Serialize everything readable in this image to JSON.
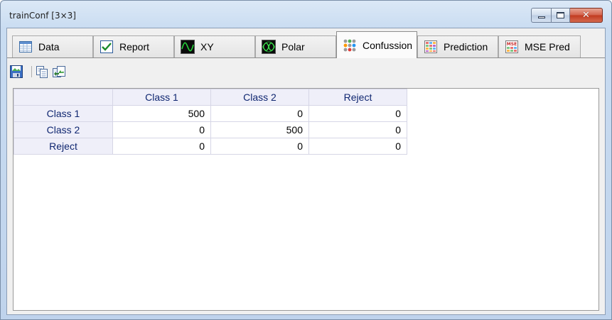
{
  "window": {
    "title": "trainConf [3×3]",
    "buttons": {
      "minimize": "minimize",
      "maximize": "maximize",
      "close": "✕"
    }
  },
  "tabs": [
    {
      "label": "Data",
      "icon": "table-icon",
      "active": false
    },
    {
      "label": "Report",
      "icon": "checkmark-icon",
      "active": false
    },
    {
      "label": "XY",
      "icon": "waveform-icon",
      "active": false
    },
    {
      "label": "Polar",
      "icon": "polar-plot-icon",
      "active": false
    },
    {
      "label": "Confussion",
      "icon": "colored-dots-icon",
      "active": true
    },
    {
      "label": "Prediction",
      "icon": "colored-grid-icon",
      "active": false
    },
    {
      "label": "MSE Pred",
      "icon": "mse-icon",
      "active": false
    }
  ],
  "mse_icon_text": "MSE",
  "toolbar": [
    {
      "name": "save-image-icon"
    },
    {
      "name": "copy-icon"
    },
    {
      "name": "export-icon"
    }
  ],
  "grid": {
    "columns": [
      "Class 1",
      "Class 2",
      "Reject"
    ],
    "rows": [
      {
        "label": "Class 1",
        "values": [
          "500",
          "0",
          "0"
        ]
      },
      {
        "label": "Class 2",
        "values": [
          "0",
          "500",
          "0"
        ]
      },
      {
        "label": "Reject",
        "values": [
          "0",
          "0",
          "0"
        ]
      }
    ]
  },
  "colors": {
    "header_bg": "#efeff9",
    "header_text": "#0f2670",
    "grid_line": "#d6d6e6",
    "close_button": "#c1391f"
  }
}
